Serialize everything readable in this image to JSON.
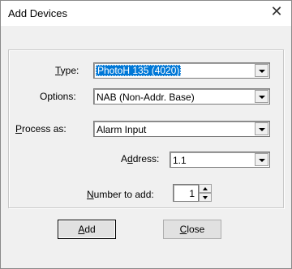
{
  "window": {
    "title": "Add Devices",
    "close_glyph": "✕"
  },
  "form": {
    "type_label_u": "T",
    "type_label_rest": "ype:",
    "type_value": "PhotoH 135 (4020)",
    "options_label": "Options:",
    "options_value": "NAB (Non-Addr. Base)",
    "process_label_u": "P",
    "process_label_rest": "rocess as:",
    "process_value": "Alarm Input",
    "address_label_pre": "A",
    "address_label_u": "d",
    "address_label_rest": "dress:",
    "address_value": "1.1",
    "number_label_u": "N",
    "number_label_rest": "umber to add:",
    "number_value": "1"
  },
  "buttons": {
    "add_u": "A",
    "add_rest": "dd",
    "close_u": "C",
    "close_rest": "lose"
  },
  "icons": {
    "dropdown": "chevron-down-icon",
    "spin_up": "arrow-up-icon",
    "spin_down": "arrow-down-icon"
  }
}
